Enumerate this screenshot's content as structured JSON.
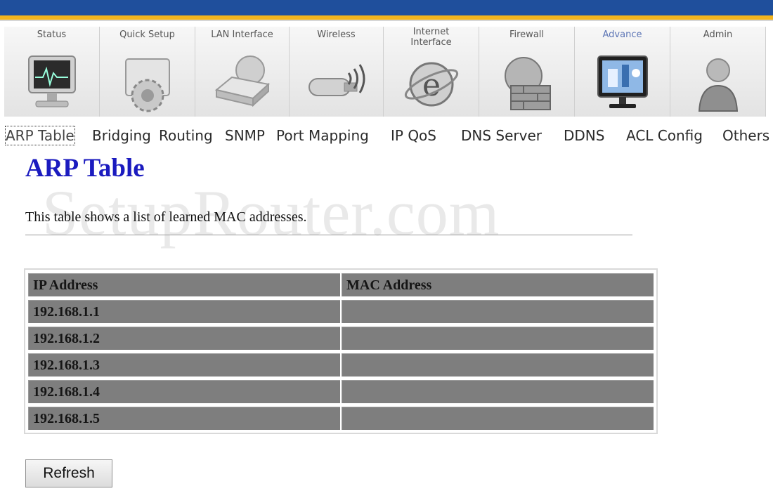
{
  "main_nav": [
    {
      "label": "Status",
      "icon": "monitor-icon"
    },
    {
      "label": "Quick Setup",
      "icon": "gear-icon"
    },
    {
      "label": "LAN Interface",
      "icon": "router-icon"
    },
    {
      "label": "Wireless",
      "icon": "wireless-adapter-icon"
    },
    {
      "label": "Internet\nInterface",
      "icon": "internet-explorer-icon"
    },
    {
      "label": "Firewall",
      "icon": "firewall-icon"
    },
    {
      "label": "Advance",
      "icon": "advance-monitor-icon"
    },
    {
      "label": "Admin",
      "icon": "user-icon"
    }
  ],
  "sub_nav": [
    "ARP Table",
    "Bridging",
    "Routing",
    "SNMP",
    "Port Mapping",
    "IP QoS",
    "DNS Server",
    "DDNS",
    "ACL Config",
    "Others"
  ],
  "page": {
    "title": "ARP Table",
    "description": "This table shows a list of learned MAC addresses.",
    "watermark": "SetupRouter.com"
  },
  "table": {
    "headers": [
      "IP Address",
      "MAC Address"
    ],
    "rows": [
      {
        "ip": "192.168.1.1",
        "mac": ""
      },
      {
        "ip": "192.168.1.2",
        "mac": ""
      },
      {
        "ip": "192.168.1.3",
        "mac": ""
      },
      {
        "ip": "192.168.1.4",
        "mac": ""
      },
      {
        "ip": "192.168.1.5",
        "mac": ""
      }
    ]
  },
  "buttons": {
    "refresh": "Refresh"
  },
  "colors": {
    "brand_blue": "#1f4f9c",
    "accent_yellow": "#f2b41d",
    "title_blue": "#1b1bbf",
    "cell_gray": "#7e7e7e"
  }
}
